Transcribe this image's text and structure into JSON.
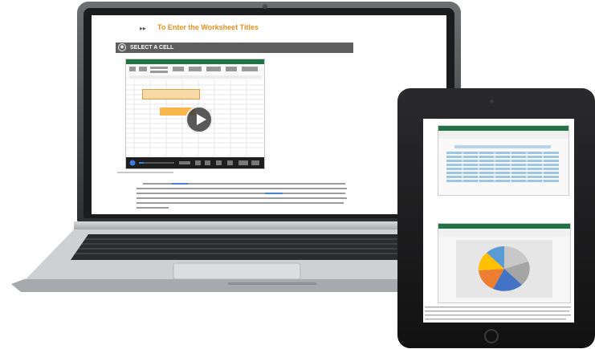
{
  "laptop": {
    "section_title": "To Enter the Worksheet Titles",
    "section_icon": "arrow-icon",
    "video_panel_label": "SELECT A CELL",
    "video_callout": "",
    "play_icon": "play-icon"
  },
  "tablet": {
    "figure_tag": "",
    "figure_label": "",
    "chart_type": "pie"
  },
  "colors": {
    "accent": "#e88f1e",
    "panel_bar": "#5e5e5e",
    "excel_green": "#217346"
  }
}
